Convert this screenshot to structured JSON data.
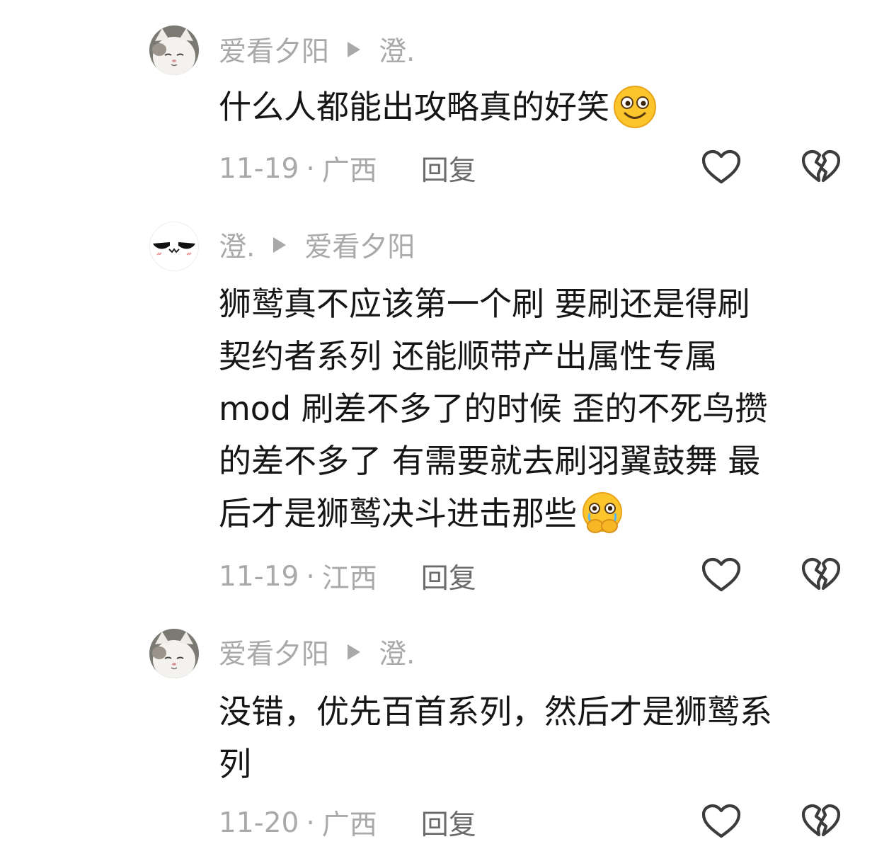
{
  "comments": [
    {
      "author": "爱看夕阳",
      "reply_to": "澄.",
      "text": "什么人都能出攻略真的好笑",
      "emoji": "smiling-face-emoji",
      "date": "11-19",
      "location": "广西",
      "reply_label": "回复",
      "avatar": "white-cat-avatar"
    },
    {
      "author": "澄.",
      "reply_to": "爱看夕阳",
      "text_lines": [
        "狮鹫真不应该第一个刷 要刷还是得刷",
        "契约者系列 还能顺带产出属性专属",
        "mod 刷差不多了的时候 歪的不死鸟攒",
        "的差不多了 有需要就去刷羽翼鼓舞 最",
        "后才是狮鹫决斗进击那些"
      ],
      "emoji": "crying-face-emoji",
      "date": "11-19",
      "location": "江西",
      "reply_label": "回复",
      "avatar": "cartoon-face-avatar"
    },
    {
      "author": "爱看夕阳",
      "reply_to": "澄.",
      "text_lines": [
        "没错，优先百首系列，然后才是狮鹫系",
        "列"
      ],
      "date": "11-20",
      "location": "广西",
      "reply_label": "回复",
      "avatar": "white-cat-avatar"
    }
  ],
  "colors": {
    "text": "#161616",
    "muted": "#a9a9a9",
    "reply_button": "#6b6b6b",
    "icon_stroke": "#3c3c3c"
  },
  "icons": {
    "like": "heart-outline-icon",
    "dislike": "broken-heart-icon",
    "reply_arrow": "play-triangle-icon"
  }
}
